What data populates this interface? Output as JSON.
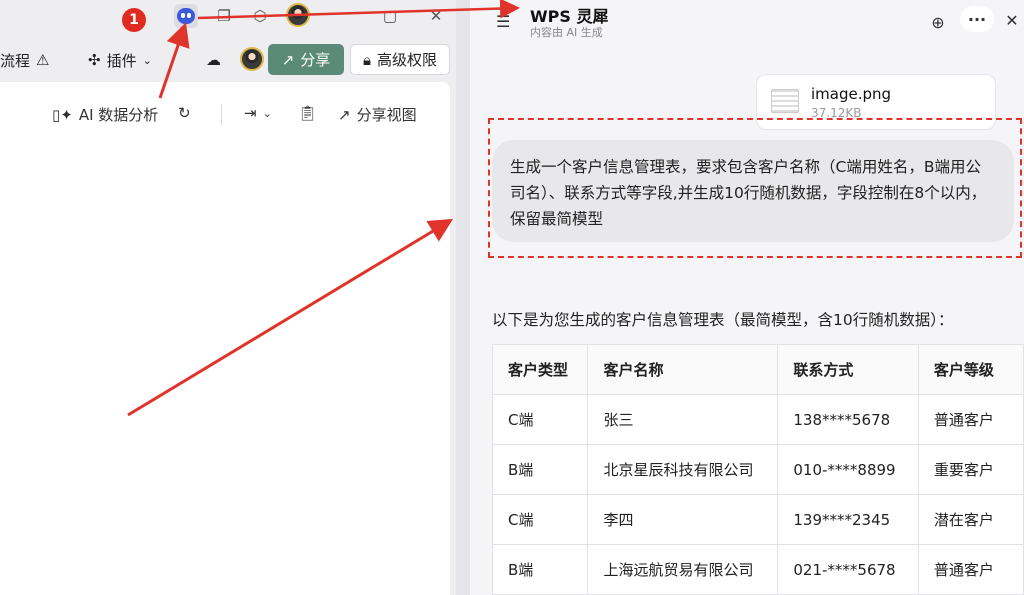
{
  "left": {
    "badge_number": "1",
    "toolbar": {
      "workflow_label": "流程",
      "plugin_label": "插件",
      "share_label": "分享",
      "permission_label": "高级权限"
    },
    "canvas_toolbar": {
      "ai_analysis_label": "AI 数据分析",
      "share_view_label": "分享视图"
    }
  },
  "panel": {
    "title": "WPS 灵犀",
    "subtitle": "内容由 AI 生成",
    "file": {
      "name": "image.png",
      "size": "37.12KB"
    },
    "prompt": "生成一个客户信息管理表，要求包含客户名称（C端用姓名，B端用公司名）、联系方式等字段,并生成10行随机数据，字段控制在8个以内，保留最简模型",
    "answer": "以下是为您生成的客户信息管理表（最简模型，含10行随机数据）：",
    "table": {
      "headers": [
        "客户类型",
        "客户名称",
        "联系方式",
        "客户等级"
      ],
      "rows": [
        [
          "C端",
          "张三",
          "138****5678",
          "普通客户"
        ],
        [
          "B端",
          "北京星辰科技有限公司",
          "010-****8899",
          "重要客户"
        ],
        [
          "C端",
          "李四",
          "139****2345",
          "潜在客户"
        ],
        [
          "B端",
          "上海远航贸易有限公司",
          "021-****5678",
          "普通客户"
        ]
      ]
    }
  },
  "colors": {
    "annotation_red": "#e0342a",
    "share_button": "#5b8a78",
    "agent_icon": "#3b5bdb"
  }
}
